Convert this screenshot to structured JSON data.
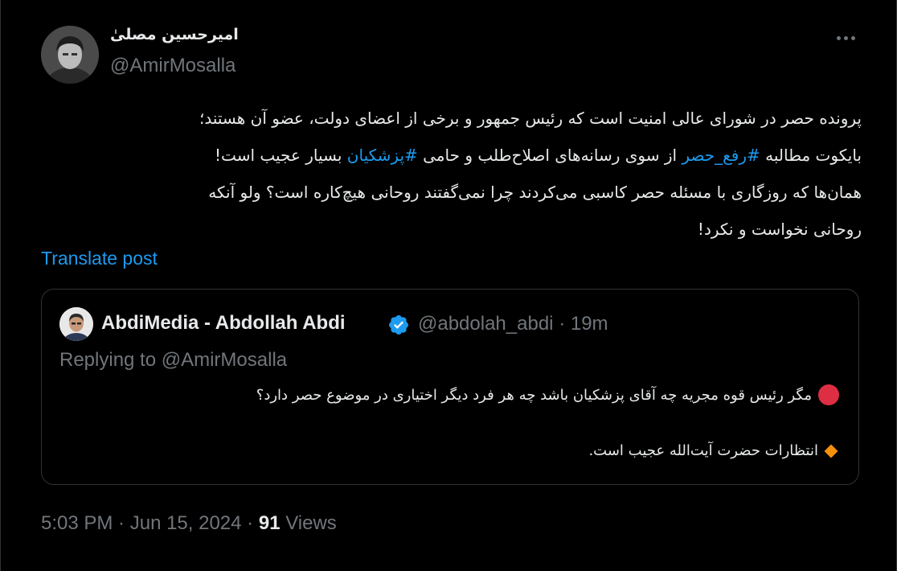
{
  "post": {
    "author": {
      "display_name": "امیرحسین مصلیٰ",
      "handle": "@AmirMosalla",
      "avatar_icon": "user-photo"
    },
    "more_icon": "more-horizontal-icon",
    "body": {
      "line1": "پرونده حصر در شورای عالی امنیت است که رئیس جمهور و برخی از اعضای دولت، عضو آن هستند؛",
      "line2_start": "بایکوت مطالبه ",
      "line2_hashtag1": "#رفع_حصر",
      "line2_mid": " از سوی رسانه‌های اصلاح‌طلب و حامی ",
      "line2_hashtag2": "#پزشکیان",
      "line2_end": " بسیار عجیب است!",
      "line3": "همان‌ها که روزگاری با مسئله حصر کاسبی می‌کردند چرا نمی‌گفتند روحانی هیچ‌کاره است؟ ولو آنکه",
      "line4": "روحانی نخواست و نکرد!"
    },
    "translate_label": "Translate post",
    "quote": {
      "author_name": "AbdiMedia - Abdollah Abdi",
      "verified_icon": "verified-badge-icon",
      "handle": "@abdolah_abdi",
      "separator": "·",
      "time_ago": "19m",
      "replying_to": "Replying to @AmirMosalla",
      "line1_icon": "red-circle-emoji",
      "line1": "مگر رئیس قوه مجریه چه آقای پزشکیان باشد چه هر فرد دیگر اختیاری در موضوع حصر دارد؟",
      "line2_icon": "orange-diamond-emoji",
      "line2": "انتظارات حضرت آیت‌الله عجیب است."
    },
    "footer": {
      "time": "5:03 PM",
      "sep1": " · ",
      "date": "Jun 15, 2024",
      "sep2": " · ",
      "views_count": "91",
      "views_label": " Views"
    }
  },
  "colors": {
    "background": "#000000",
    "text": "#e7e9ea",
    "muted": "#71767b",
    "link": "#1d9bf0",
    "border": "#2f3336",
    "red_emoji": "#dd2e44",
    "orange_emoji": "#f4900c"
  }
}
